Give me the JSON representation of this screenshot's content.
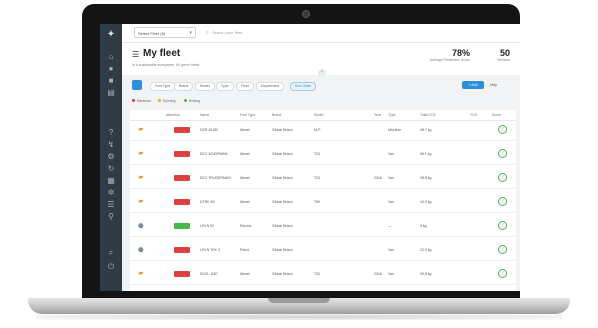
{
  "topbar": {
    "fleet_select": "Select Fleet (8)",
    "search_placeholder": "Search your fleet"
  },
  "header": {
    "title": "My fleet",
    "subtitle": "In a sustainable ecosystem, 60 green fleets",
    "stats": [
      {
        "value": "78%",
        "label": "Average FleetIndex Score"
      },
      {
        "value": "50",
        "label": "Vehicles"
      }
    ]
  },
  "filters": {
    "chips": [
      "Fuel Type",
      "Brand",
      "Model",
      "Type",
      "Fleet",
      "Department",
      "Sort Order"
    ],
    "active_index": 6,
    "add_label": "+ Add",
    "help_label": "Help"
  },
  "legend": [
    "Renewal",
    "Syncing",
    "Ending"
  ],
  "table": {
    "columns": [
      "Attention",
      "Name",
      "Fuel Type",
      "Brand",
      "Model",
      "Year",
      "Type",
      "Total CO2",
      "TCO",
      "Score"
    ],
    "rows": [
      {
        "icon": "truck",
        "status": "red",
        "name": "DSR 40180",
        "fuel": "Diesel",
        "brand": "Global Brand",
        "model": "M-P",
        "year": "",
        "type": "Mid-size",
        "co2": "48.7 kg",
        "tco": "",
        "score": "✓"
      },
      {
        "icon": "truck",
        "status": "red",
        "name": "DCV 3/DEIRMAN",
        "fuel": "Diesel",
        "brand": "Global Brand",
        "model": "T20",
        "year": "",
        "type": "Van",
        "co2": "36.1 kg",
        "tco": "",
        "score": "✓"
      },
      {
        "icon": "truck",
        "status": "red",
        "name": "DCV TRUDERMAN",
        "fuel": "Diesel",
        "brand": "Global Brand",
        "model": "T20",
        "year": "2016",
        "type": "Van",
        "co2": "38.5 kg",
        "tco": "",
        "score": "✓"
      },
      {
        "icon": "truck",
        "status": "red",
        "name": "DTRK 89",
        "fuel": "Diesel",
        "brand": "Global Brand",
        "model": "T50",
        "year": "",
        "type": "Van",
        "co2": "40.2 kg",
        "tco": "",
        "score": "✓"
      },
      {
        "icon": "car",
        "status": "green",
        "name": "LEVN 92",
        "fuel": "Electric",
        "brand": "Global Brand",
        "model": "",
        "year": "",
        "type": "—",
        "co2": "0 kg",
        "tco": "",
        "score": "✓"
      },
      {
        "icon": "car",
        "status": "red",
        "name": "LEVN TEK 3",
        "fuel": "Petrol",
        "brand": "Global Brand",
        "model": "",
        "year": "",
        "type": "Van",
        "co2": "22.0 kg",
        "tco": "",
        "score": "✓"
      },
      {
        "icon": "truck",
        "status": "red",
        "name": "DCVL 1187",
        "fuel": "Diesel",
        "brand": "Global Brand",
        "model": "T30",
        "year": "2016",
        "type": "Van",
        "co2": "39.8 kg",
        "tco": "",
        "score": "✓"
      }
    ]
  },
  "colors": {
    "accent": "#2e8fd8",
    "sidebar": "#2f3b45",
    "alert_red": "#d9433b",
    "ok_green": "#49b84a"
  },
  "icons": {
    "sidebar": [
      "home-icon",
      "user-icon",
      "briefcase-icon",
      "chart-icon",
      "help-icon",
      "route-icon",
      "settings-icon",
      "refresh-icon",
      "map-icon",
      "gear-icon",
      "list-icon",
      "pin-icon",
      "search-icon",
      "power-icon"
    ]
  }
}
